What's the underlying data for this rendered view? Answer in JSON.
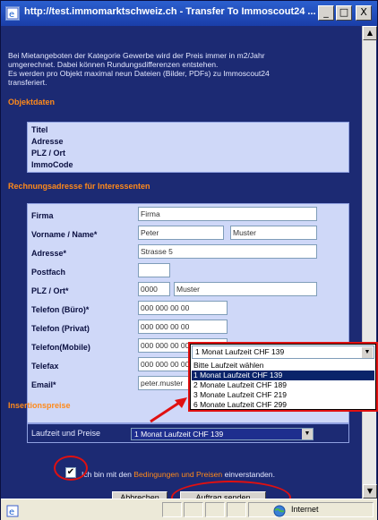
{
  "window": {
    "title": "http://test.immomarktschweiz.ch - Transfer To Immoscout24 ...",
    "minimize_label": "_",
    "maximize_label": "□",
    "close_label": "X"
  },
  "intro": {
    "line1": "Bei Mietangeboten der Kategorie Gewerbe wird der Preis immer in m2/Jahr",
    "line2": "umgerechnet. Dabei können Rundungsdifferenzen entstehen.",
    "line3": "Es werden pro Objekt maximal neun Dateien (Bilder, PDFs) zu Immoscout24",
    "line4": "transferiert."
  },
  "objektdaten": {
    "heading": "Objektdaten",
    "labels": [
      "Titel",
      "Adresse",
      "PLZ / Ort",
      "ImmoCode"
    ]
  },
  "rechnung": {
    "heading": "Rechnungsadresse für Interessenten",
    "firma_label": "Firma",
    "firma_value": "Firma",
    "name_label": "Vorname / Name*",
    "vorname_value": "Peter",
    "nachname_value": "Muster",
    "adresse_label": "Adresse*",
    "adresse_value": "Strasse 5",
    "postfach_label": "Postfach",
    "postfach_value": "",
    "plz_label": "PLZ / Ort*",
    "plz_value": "0000",
    "ort_value": "Muster",
    "tel_buero_label": "Telefon (Büro)*",
    "tel_buero_value": "000 000 00 00",
    "tel_privat_label": "Telefon (Privat)",
    "tel_privat_value": "000 000 00 00",
    "tel_mobile_label": "Telefon(Mobile)",
    "tel_mobile_value": "000 000 00 00",
    "telefax_label": "Telefax",
    "telefax_value": "000 000 00 00",
    "email_label": "Email*",
    "email_value": "peter.muster"
  },
  "dropdown": {
    "selected": "1 Monat Laufzeit CHF 139",
    "options": [
      "Bitte Laufzeit wählen",
      "1 Monat Laufzeit CHF 139",
      "2 Monate Laufzeit CHF 189",
      "3 Monate Laufzeit CHF 219",
      "6 Monate Laufzeit CHF 299"
    ]
  },
  "insertion": {
    "heading": "Insertionspreise",
    "laufzeit_label": "Laufzeit und Preise",
    "laufzeit_value": "1 Monat Laufzeit CHF 139"
  },
  "agree": {
    "checked": true,
    "check_mark": "✔",
    "prefix": "Ich bin mit den ",
    "link": "Bedingungen und Preisen",
    "suffix": " einverstanden."
  },
  "buttons": {
    "cancel": "Abbrechen",
    "submit": "Auftrag senden"
  },
  "statusbar": {
    "zone": "Internet"
  },
  "colors": {
    "background": "#1c2a73",
    "heading": "#ff8a1a",
    "annotation": "#e01010"
  }
}
